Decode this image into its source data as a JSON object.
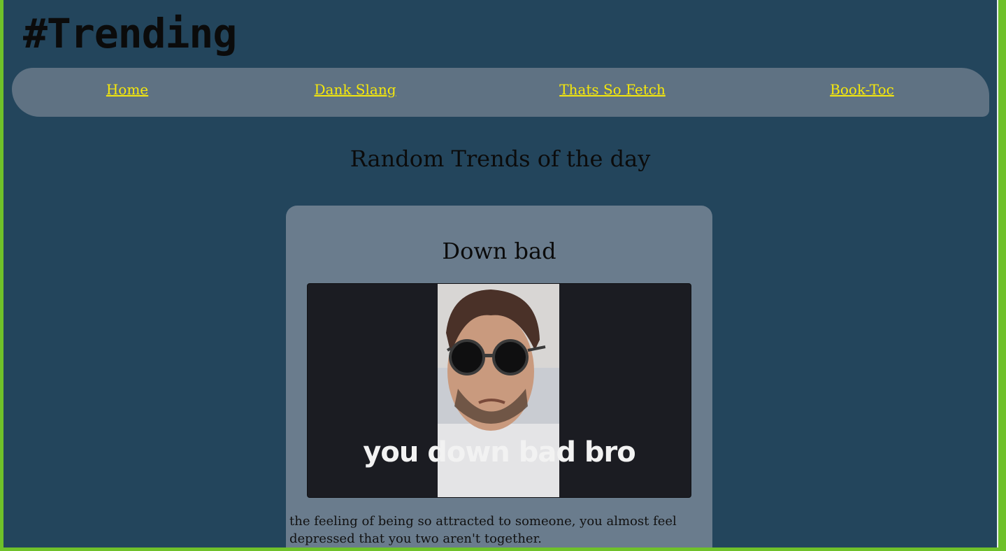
{
  "site": {
    "title": "#Trending"
  },
  "nav": {
    "items": [
      {
        "label": "Home"
      },
      {
        "label": "Dank Slang"
      },
      {
        "label": "Thats So Fetch"
      },
      {
        "label": "Book-Toc"
      }
    ]
  },
  "main": {
    "heading": "Random Trends of the day",
    "card": {
      "title": "Down bad",
      "image_caption": "you down bad bro",
      "description": "the feeling of being so attracted to someone, you almost feel depressed that you two aren't together."
    }
  },
  "colors": {
    "page_background": "#23455c",
    "outer_border": "#6fc12a",
    "nav_background": "#5f7283",
    "nav_link": "#f5e80c",
    "card_background": "#6a7c8d"
  }
}
